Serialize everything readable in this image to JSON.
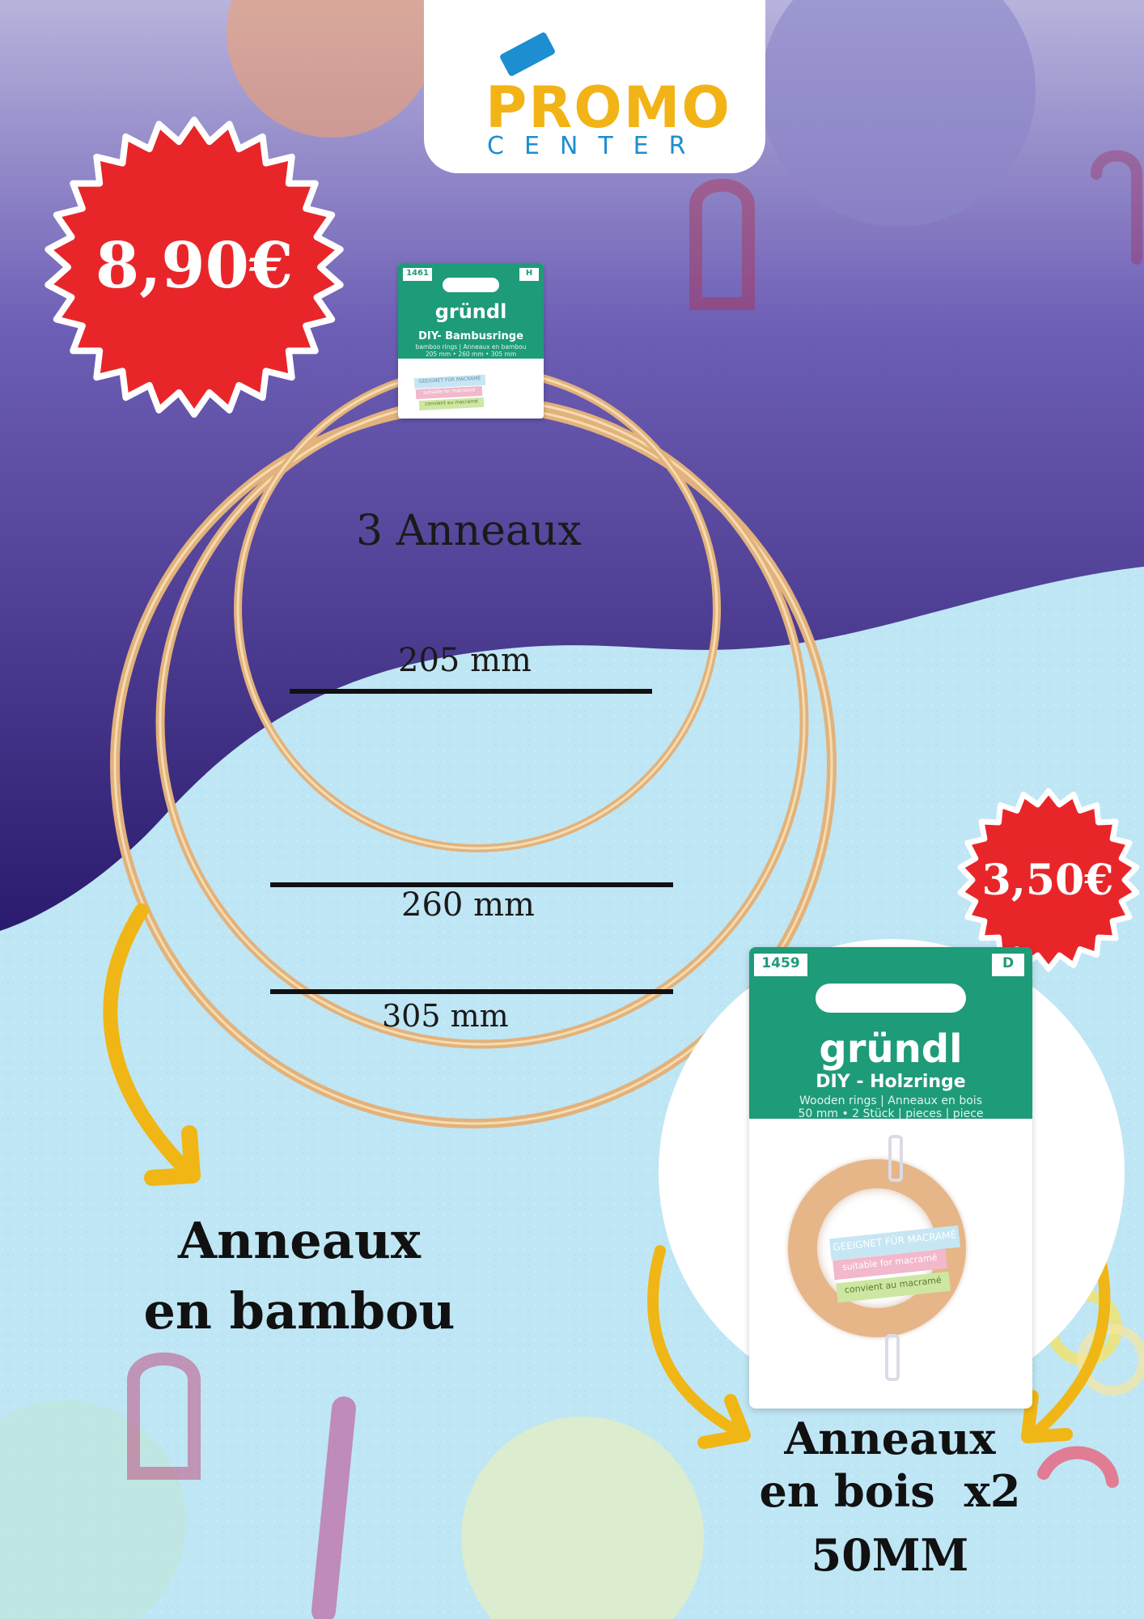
{
  "logo": {
    "line1": "PROMO",
    "line2": "CENTER"
  },
  "prices": {
    "bamboo": "8,90€",
    "wood": "3,50€"
  },
  "bamboo_rings": {
    "count_label": "3 Anneaux",
    "sizes": [
      "205 mm",
      "260 mm",
      "305 mm"
    ],
    "product_name": [
      "Anneaux",
      "en bambou"
    ]
  },
  "wood_rings": {
    "product_line1": "Anneaux",
    "product_line2": "en bois",
    "quantity": "x2",
    "size": "50MM"
  },
  "package_bamboo": {
    "code": "1461",
    "letter": "H",
    "brand": "gründl",
    "title": "DIY- Bambusringe",
    "subtitle": "bamboo rings | Anneaux en bambou",
    "sizes_line": "205 mm • 260 mm • 305 mm",
    "label1": "GEEIGNET FÜR MACRAMÉ",
    "label2": "suitable for macramé",
    "label3": "convient au macramé"
  },
  "package_wood": {
    "code": "1459",
    "letter": "D",
    "brand": "gründl",
    "title": "DIY - Holzringe",
    "subtitle": "Wooden rings | Anneaux en bois",
    "sizes_line": "50 mm • 2 Stück | pieces | piece",
    "label1": "GEEIGNET FÜR MACRAMÉ",
    "label2": "suitable for macramé",
    "label3": "convient au macramé"
  },
  "colors": {
    "purple_dark": "#2b1b6e",
    "purple_mid": "#5a4aa8",
    "light_blue": "#bfe6f4",
    "price_red": "#e8262a",
    "brand_green": "#1e9b79",
    "logo_yellow": "#f2b316",
    "logo_blue": "#1d8ecf",
    "arrow_yellow": "#f0b615",
    "bamboo": "#e2b27c"
  }
}
